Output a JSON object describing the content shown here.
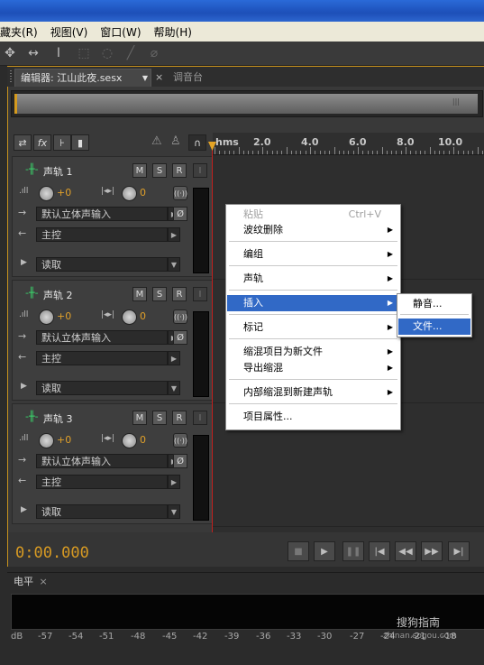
{
  "menubar": [
    "藏夹(R)",
    "视图(V)",
    "窗口(W)",
    "帮助(H)"
  ],
  "tabs": {
    "editor": "编辑器: 江山此夜.sesx",
    "editor_dropdown": "▼",
    "editor_close": "×",
    "mixer": "调音台"
  },
  "ruler": {
    "unit": "hms",
    "labels": [
      "2.0",
      "4.0",
      "6.0",
      "8.0",
      "10.0"
    ]
  },
  "track_buttons": {
    "mute": "M",
    "solo": "S",
    "record": "R",
    "input": "I"
  },
  "tracks": [
    {
      "name": "声轨 1",
      "volume": "+0",
      "pan": "0",
      "input": "默认立体声输入",
      "output": "主控",
      "automation": "读取"
    },
    {
      "name": "声轨 2",
      "volume": "+0",
      "pan": "0",
      "input": "默认立体声输入",
      "output": "主控",
      "automation": "读取"
    },
    {
      "name": "声轨 3",
      "volume": "+0",
      "pan": "0",
      "input": "默认立体声输入",
      "output": "主控",
      "automation": "读取"
    }
  ],
  "context_menu": {
    "paste": "粘贴",
    "paste_shortcut": "Ctrl+V",
    "ripple_delete": "波纹删除",
    "group": "编组",
    "track": "声轨",
    "insert": "插入",
    "marker": "标记",
    "mixdown_new_file": "缩混项目为新文件",
    "export_mixdown": "导出缩混",
    "bounce_new_track": "内部缩混到新建声轨",
    "properties": "项目属性..."
  },
  "submenu": {
    "silence": "静音...",
    "file": "文件..."
  },
  "transport": {
    "timecode": "0:00.000"
  },
  "level_panel": {
    "tab": "电平",
    "close": "×",
    "scale": [
      "dB",
      "-57",
      "-54",
      "-51",
      "-48",
      "-45",
      "-42",
      "-39",
      "-36",
      "-33",
      "-30",
      "-27",
      "-24",
      "-21",
      "-18"
    ]
  },
  "watermark": {
    "text": "搜狗指南",
    "url": "zhinan.sogou.com"
  },
  "colors": {
    "accent": "#d79a23",
    "selection": "#3169c6",
    "playhead": "#c0201e",
    "wave_icon": "#3bd26b"
  }
}
